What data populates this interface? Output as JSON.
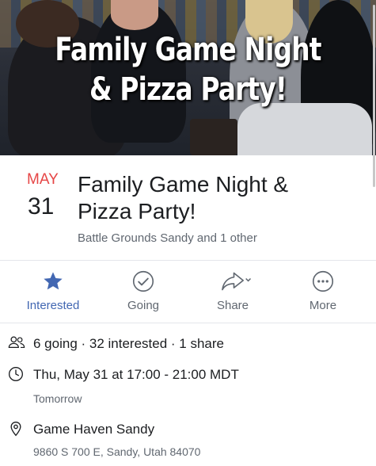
{
  "cover": {
    "title_line1": "Family Game Night",
    "title_line2": "& Pizza Party!"
  },
  "event": {
    "month": "MAY",
    "day": "31",
    "title": "Family Game Night & Pizza Party!",
    "hosts": "Battle Grounds Sandy and 1 other"
  },
  "actions": [
    {
      "label": "Interested",
      "icon": "star-icon",
      "active": true
    },
    {
      "label": "Going",
      "icon": "check-circle-icon",
      "active": false
    },
    {
      "label": "Share",
      "icon": "share-icon",
      "active": false
    },
    {
      "label": "More",
      "icon": "more-icon",
      "active": false
    }
  ],
  "details": {
    "attendance": "6 going · 32 interested · 1 share",
    "datetime": "Thu, May 31 at 17:00 - 21:00 MDT",
    "relative_day": "Tomorrow",
    "venue": "Game Haven Sandy",
    "address": "9860 S 700 E, Sandy, Utah 84070"
  },
  "colors": {
    "accent": "#4267b2",
    "month": "#e64646",
    "text": "#1c1e21",
    "secondary": "#606770"
  }
}
